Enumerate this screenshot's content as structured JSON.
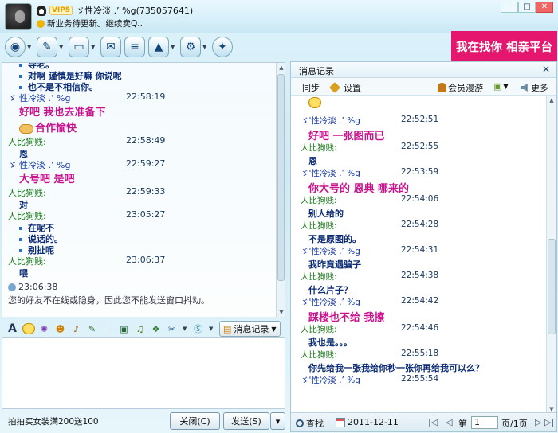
{
  "title_bar": {
    "vip_label": "VIP5",
    "nick_id": "ゞ性冷淡  .’  %g(735057641)",
    "signature": "新业务待更新。继续卖Q..",
    "win_min": "─",
    "win_max": "□",
    "win_close": "✕"
  },
  "ad_banner": "我在找你 相亲平台",
  "toolbar": {
    "items": [
      "camera-icon",
      "microphone-icon",
      "folder-icon",
      "mail-icon",
      "notes-icon",
      "app-icon",
      "settings-icon",
      "apps-circle-icon"
    ]
  },
  "chat": {
    "me_name": "ゞ'性冷淡  .’  %g",
    "friend_name": "人比狗贱:",
    "lines": [
      {
        "kind": "dot",
        "text": "导老。"
      },
      {
        "kind": "dot",
        "text": "对啊 谨慎是好嘛 你说呢"
      },
      {
        "kind": "dot",
        "text": "也不是不相信你。"
      },
      {
        "kind": "me",
        "time": "22:58:19"
      },
      {
        "kind": "pink",
        "text": "好吧  我也去准备下"
      },
      {
        "kind": "pinkhands",
        "text": "合作愉快"
      },
      {
        "kind": "friend",
        "time": "22:58:49"
      },
      {
        "kind": "text",
        "text": "恩"
      },
      {
        "kind": "me",
        "time": "22:59:27"
      },
      {
        "kind": "pink",
        "text": "大号吧  是吧"
      },
      {
        "kind": "friend",
        "time": "22:59:33"
      },
      {
        "kind": "text",
        "text": "对"
      },
      {
        "kind": "friend",
        "time": "23:05:27"
      },
      {
        "kind": "dot",
        "text": "在呢不"
      },
      {
        "kind": "dot",
        "text": "说话的。"
      },
      {
        "kind": "dot",
        "text": "别扯呢"
      },
      {
        "kind": "friend",
        "time": "23:06:37"
      },
      {
        "kind": "text",
        "text": "喂"
      }
    ],
    "sys_time": "23:06:38",
    "sys_msg": "您的好友不在线或隐身，因此您不能发送窗口抖动。"
  },
  "format_bar": {
    "font_label": "A",
    "history_button": "消息记录"
  },
  "bottom": {
    "ad_text": "拍拍买女装满200送100",
    "close_button": "关闭(C)",
    "send_button": "发送(S)",
    "send_arrow": "▾"
  },
  "history": {
    "title": "消息记录",
    "close": "✕",
    "sync_label": "同步",
    "settings_label": "设置",
    "member_label": "会员漫游",
    "more_label": "更多",
    "items": [
      {
        "kind": "emoji"
      },
      {
        "kind": "me",
        "time": "22:52:51"
      },
      {
        "kind": "pink",
        "text": "好吧   一张图而已"
      },
      {
        "kind": "friend",
        "time": "22:52:55"
      },
      {
        "kind": "text",
        "text": "恩"
      },
      {
        "kind": "me",
        "time": "22:53:59"
      },
      {
        "kind": "pink",
        "text": "你大号的    恩典  哪来的"
      },
      {
        "kind": "friend",
        "time": "22:54:06"
      },
      {
        "kind": "text",
        "text": "别人给的"
      },
      {
        "kind": "friend",
        "time": "22:54:28"
      },
      {
        "kind": "text",
        "text": "不是原图的。"
      },
      {
        "kind": "me",
        "time": "22:54:31"
      },
      {
        "kind": "text",
        "text": "我昨竟遇骗子"
      },
      {
        "kind": "friend",
        "time": "22:54:38"
      },
      {
        "kind": "text",
        "text": "什么片子？"
      },
      {
        "kind": "me",
        "time": "22:54:42"
      },
      {
        "kind": "pink",
        "text": "踩楼也不给  我擦"
      },
      {
        "kind": "friend",
        "time": "22:54:46"
      },
      {
        "kind": "text",
        "text": "我也是。。。"
      },
      {
        "kind": "friend",
        "time": "22:55:18"
      },
      {
        "kind": "text",
        "text": "你先给我一张我给你秒一张你再给我可以么？"
      },
      {
        "kind": "me",
        "time": "22:55:54"
      }
    ],
    "footer": {
      "search_label": "查找",
      "date": "2011-12-11",
      "page_prefix": "第",
      "page_value": "1",
      "page_suffix": "页/1页"
    }
  }
}
